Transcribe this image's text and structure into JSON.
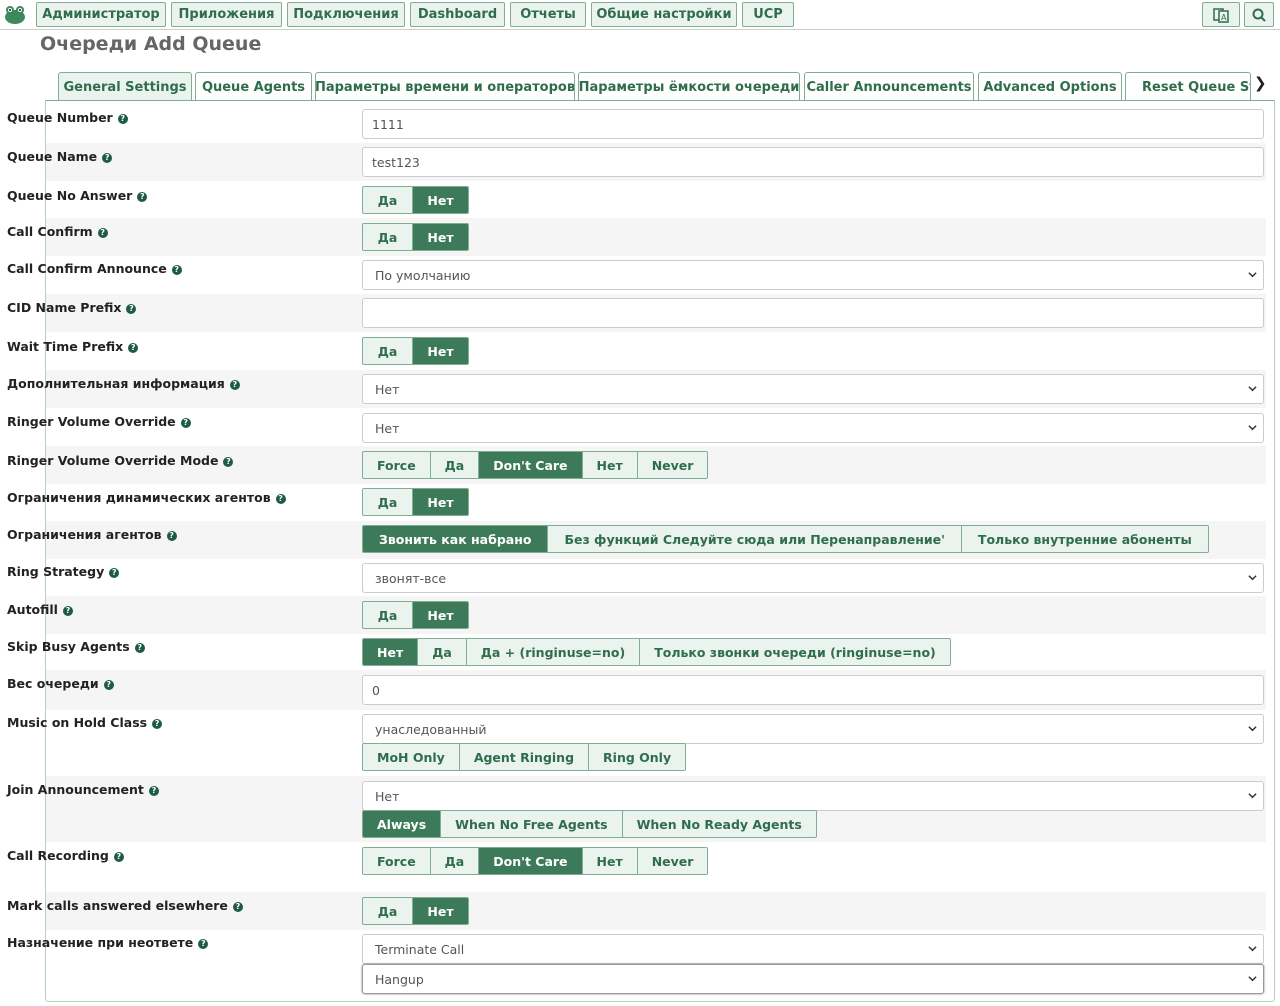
{
  "nav": {
    "items": [
      "Администратор",
      "Приложения",
      "Подключения",
      "Dashboard",
      "Отчеты",
      "Общие настройки",
      "UCP"
    ]
  },
  "page_title": "Очереди Add Queue",
  "tabs": [
    "General Settings",
    "Queue Agents",
    "Параметры времени и операторов",
    "Параметры ёмкости очереди",
    "Caller Announcements",
    "Advanced Options",
    "Reset Queue Stat"
  ],
  "active_tab": "General Settings",
  "form": {
    "queue_number": {
      "label": "Queue Number",
      "value": "1111"
    },
    "queue_name": {
      "label": "Queue Name",
      "value": "test123"
    },
    "queue_no_answer": {
      "label": "Queue No Answer",
      "options": [
        "Да",
        "Нет"
      ],
      "selected": "Нет"
    },
    "call_confirm": {
      "label": "Call Confirm",
      "options": [
        "Да",
        "Нет"
      ],
      "selected": "Нет"
    },
    "call_confirm_announce": {
      "label": "Call Confirm Announce",
      "value": "По умолчанию"
    },
    "cid_name_prefix": {
      "label": "CID Name Prefix",
      "value": ""
    },
    "wait_time_prefix": {
      "label": "Wait Time Prefix",
      "options": [
        "Да",
        "Нет"
      ],
      "selected": "Нет"
    },
    "extra_info": {
      "label": "Дополнительная информация",
      "value": "Нет"
    },
    "ringer_volume_override": {
      "label": "Ringer Volume Override",
      "value": "Нет"
    },
    "ringer_volume_override_mode": {
      "label": "Ringer Volume Override Mode",
      "options": [
        "Force",
        "Да",
        "Don't Care",
        "Нет",
        "Never"
      ],
      "selected": "Don't Care"
    },
    "dynamic_agents_limit": {
      "label": "Ограничения динамических агентов",
      "options": [
        "Да",
        "Нет"
      ],
      "selected": "Нет"
    },
    "agent_restrictions": {
      "label": "Ограничения агентов",
      "options": [
        "Звонить как набрано",
        "Без функций Следуйте сюда или Перенаправление'",
        "Только внутренние абоненты"
      ],
      "selected": "Звонить как набрано"
    },
    "ring_strategy": {
      "label": "Ring Strategy",
      "value": "звонят-все"
    },
    "autofill": {
      "label": "Autofill",
      "options": [
        "Да",
        "Нет"
      ],
      "selected": "Нет"
    },
    "skip_busy_agents": {
      "label": "Skip Busy Agents",
      "options": [
        "Нет",
        "Да",
        "Да + (ringinuse=no)",
        "Только звонки очереди (ringinuse=no)"
      ],
      "selected": "Нет"
    },
    "queue_weight": {
      "label": "Вес очереди",
      "value": "0"
    },
    "moh_class": {
      "label": "Music on Hold Class",
      "value": "унаследованный",
      "options": [
        "MoH Only",
        "Agent Ringing",
        "Ring Only"
      ],
      "selected": ""
    },
    "join_announcement": {
      "label": "Join Announcement",
      "value": "Нет",
      "options": [
        "Always",
        "When No Free Agents",
        "When No Ready Agents"
      ],
      "selected": "Always"
    },
    "call_recording": {
      "label": "Call Recording",
      "options": [
        "Force",
        "Да",
        "Don't Care",
        "Нет",
        "Never"
      ],
      "selected": "Don't Care"
    },
    "mark_calls": {
      "label": "Mark calls answered elsewhere",
      "options": [
        "Да",
        "Нет"
      ],
      "selected": "Нет"
    },
    "fail_destination": {
      "label": "Назначение при неответе",
      "value": "Terminate Call",
      "value2": "Hangup"
    }
  },
  "colors": {
    "accent": "#3c7a59",
    "accent_light": "#eaf3ee",
    "border": "#7fae94"
  }
}
